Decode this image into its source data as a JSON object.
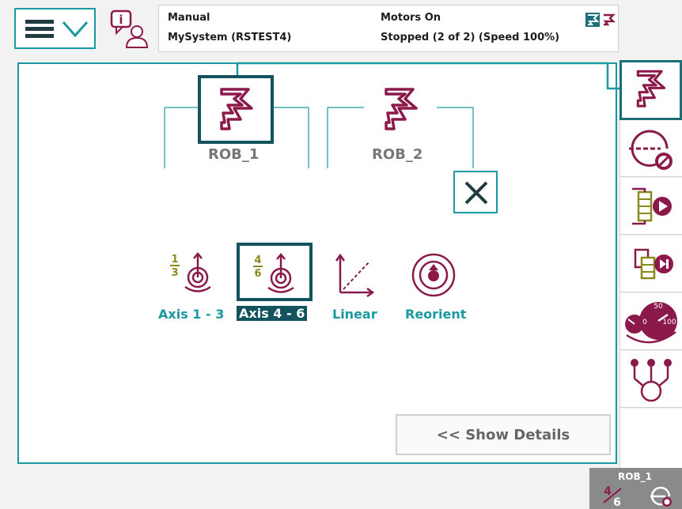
{
  "header": {
    "mode": "Manual",
    "system": "MySystem (RSTEST4)",
    "motors": "Motors On",
    "program_state": "Stopped (2 of 2) (Speed 100%)"
  },
  "robots": [
    {
      "label": "ROB_1",
      "selected": true
    },
    {
      "label": "ROB_2",
      "selected": false
    }
  ],
  "jog_modes": [
    {
      "label": "Axis 1 - 3",
      "selected": false
    },
    {
      "label": "Axis 4 - 6",
      "selected": true
    },
    {
      "label": "Linear",
      "selected": false
    },
    {
      "label": "Reorient",
      "selected": false
    }
  ],
  "axis_fractions": {
    "axis_1_3": [
      "1",
      "3"
    ],
    "axis_4_6": [
      "4",
      "6"
    ]
  },
  "speed_gauge": {
    "ticks": [
      "0",
      "50",
      "100"
    ]
  },
  "show_details_label": "<< Show Details",
  "quickset_status": {
    "robot": "ROB_1"
  },
  "colors": {
    "accent": "#1a9aa0",
    "robot": "#8b1a4a",
    "dark_accent": "#12535e",
    "olive": "#8a8a1e"
  },
  "icons": [
    "menu-icon",
    "chevron-down-icon",
    "info-user-icon",
    "robot-icon",
    "close-icon",
    "lead-through-icon",
    "run-mode-icon",
    "step-mode-icon",
    "speed-gauge-icon",
    "tasks-icon"
  ]
}
